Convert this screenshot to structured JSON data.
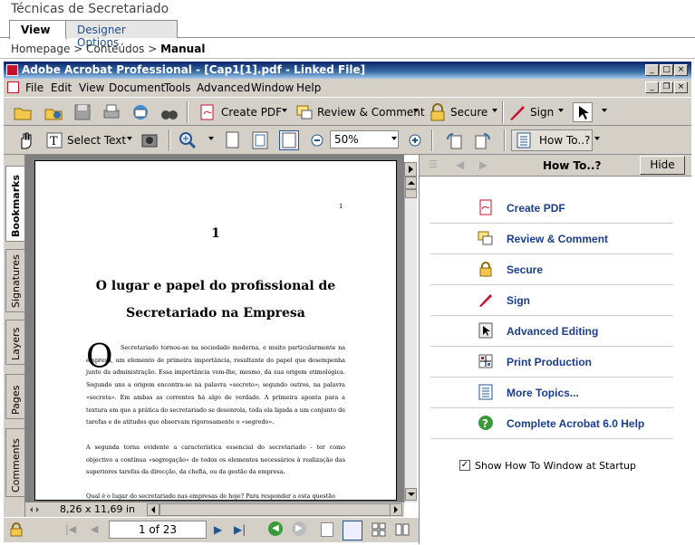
{
  "site": {
    "title": "Técnicas de Secretariado",
    "tabs": [
      "View",
      "Designer Options"
    ]
  },
  "breadcrumb": {
    "home": "Homepage",
    "sep1": ">",
    "contents": "Conteúdos",
    "sep2": ">",
    "current": "Manual"
  },
  "window": {
    "title": "Adobe Acrobat Professional - [Cap1[1].pdf - Linked File]"
  },
  "menu": [
    "File",
    "Edit",
    "View",
    "Document",
    "Tools",
    "Advanced",
    "Window",
    "Help"
  ],
  "toolbar1": {
    "create_pdf": "Create PDF",
    "review": "Review & Comment",
    "secure": "Secure",
    "sign": "Sign"
  },
  "toolbar2": {
    "select_text": "Select Text",
    "zoom": "50%",
    "howto": "How To..?"
  },
  "side_tabs": [
    "Bookmarks",
    "Signatures",
    "Layers",
    "Pages",
    "Comments"
  ],
  "document": {
    "chapter": "1",
    "title_line1": "O lugar e papel do profissional de",
    "title_line2": "Secretariado na Empresa",
    "corner": "1",
    "dropcap": "O",
    "para1": "Secretariado tornou-se na sociedade moderna, e muito particularmente na empresa, um elemento de primeira importância, resultante do papel que desempenha junto da administração. Essa importância vem-lhe, mesmo, da sua origem etimológica. Segundo uns a origem encontra-se na palavra «secreto»; segundo outros, na palavra «secreta». Em ambas as correntes há algo de verdade. A primeira aponta para a textura em que a prática do secretariado se desenrola, toda ela ligada a um conjunto de tarefas e de atitudes que observam rigorosamente o «segredo».",
    "para2": "A segunda torna evidente a característica essencial do secretariado - ter como objectivo a contínua «segregação» de todos os elementos necessários à realização das superiores tarefas da direcção, da chefia, ou da gestão da empresa.",
    "para3": "Qual é o lugar do secretariado nas empresas de hoje? Para responder a esta questão"
  },
  "page_size": "8,26 x 11,69 in",
  "page_nav": "1 of 23",
  "howto": {
    "title": "How To..?",
    "hide": "Hide",
    "items": [
      "Create PDF",
      "Review & Comment",
      "Secure",
      "Sign",
      "Advanced Editing",
      "Print Production",
      "More Topics...",
      "Complete Acrobat 6.0 Help"
    ],
    "checkbox_label": "Show How To Window at Startup",
    "checkbox_checked": true
  }
}
